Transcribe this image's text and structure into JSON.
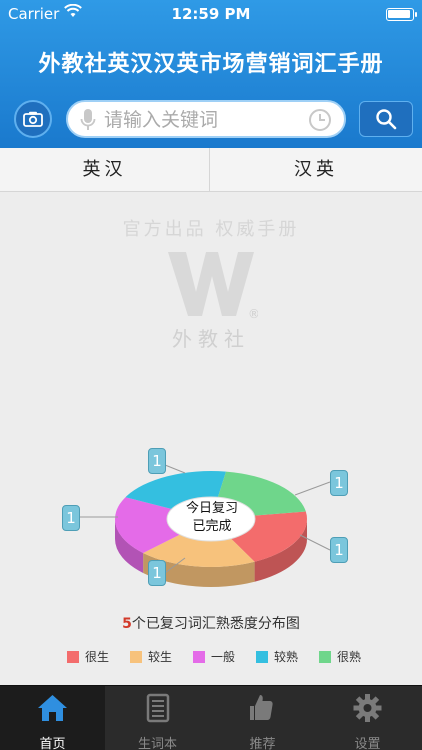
{
  "status_bar": {
    "carrier": "Carrier",
    "time": "12:59 PM"
  },
  "header": {
    "title": "外教社英汉汉英市场营销词汇手册"
  },
  "search": {
    "placeholder": "请输入关键词"
  },
  "tabs": [
    {
      "label": "英汉"
    },
    {
      "label": "汉英"
    }
  ],
  "branding": {
    "slogan": "官方出品 权威手册",
    "logo_name": "外教社",
    "logo_mark": "W",
    "registered": "®"
  },
  "review_chart": {
    "center_label_line1": "今日复习",
    "center_label_line2": "已完成",
    "caption_count": "5",
    "caption_text": "个已复习词汇熟悉度分布图"
  },
  "chart_data": {
    "type": "pie",
    "categories": [
      "很生",
      "较生",
      "一般",
      "较熟",
      "很熟"
    ],
    "values": [
      1,
      1,
      1,
      1,
      1
    ],
    "colors": [
      "#f36c6c",
      "#f7c27c",
      "#e46be8",
      "#34bfe0",
      "#6fd68b"
    ],
    "title": "5个已复习词汇熟悉度分布图"
  },
  "tab_bar": [
    {
      "label": "首页",
      "icon": "home-icon",
      "active": true
    },
    {
      "label": "生词本",
      "icon": "notebook-icon",
      "active": false
    },
    {
      "label": "推荐",
      "icon": "thumbs-up-icon",
      "active": false
    },
    {
      "label": "设置",
      "icon": "gear-icon",
      "active": false
    }
  ]
}
